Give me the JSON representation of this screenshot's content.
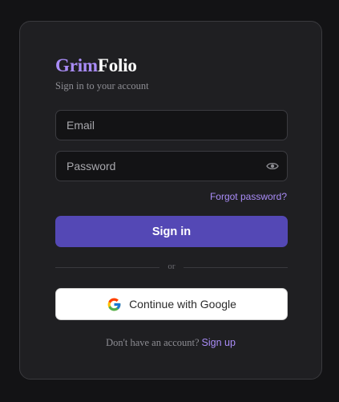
{
  "brand": {
    "part1": "Grim",
    "part2": "Folio",
    "accent": "#a98cf7"
  },
  "subtitle": "Sign in to your account",
  "form": {
    "email": {
      "value": "",
      "placeholder": "Email"
    },
    "password": {
      "value": "",
      "placeholder": "Password",
      "toggle_icon": "eye-icon"
    },
    "forgot_label": "Forgot password?",
    "submit_label": "Sign in",
    "submit_color": "#5448b5"
  },
  "divider": {
    "text": "or"
  },
  "google": {
    "label": "Continue with Google",
    "icon": "google-icon"
  },
  "footer": {
    "prompt": "Don't have an account?",
    "signup_label": "Sign up"
  }
}
